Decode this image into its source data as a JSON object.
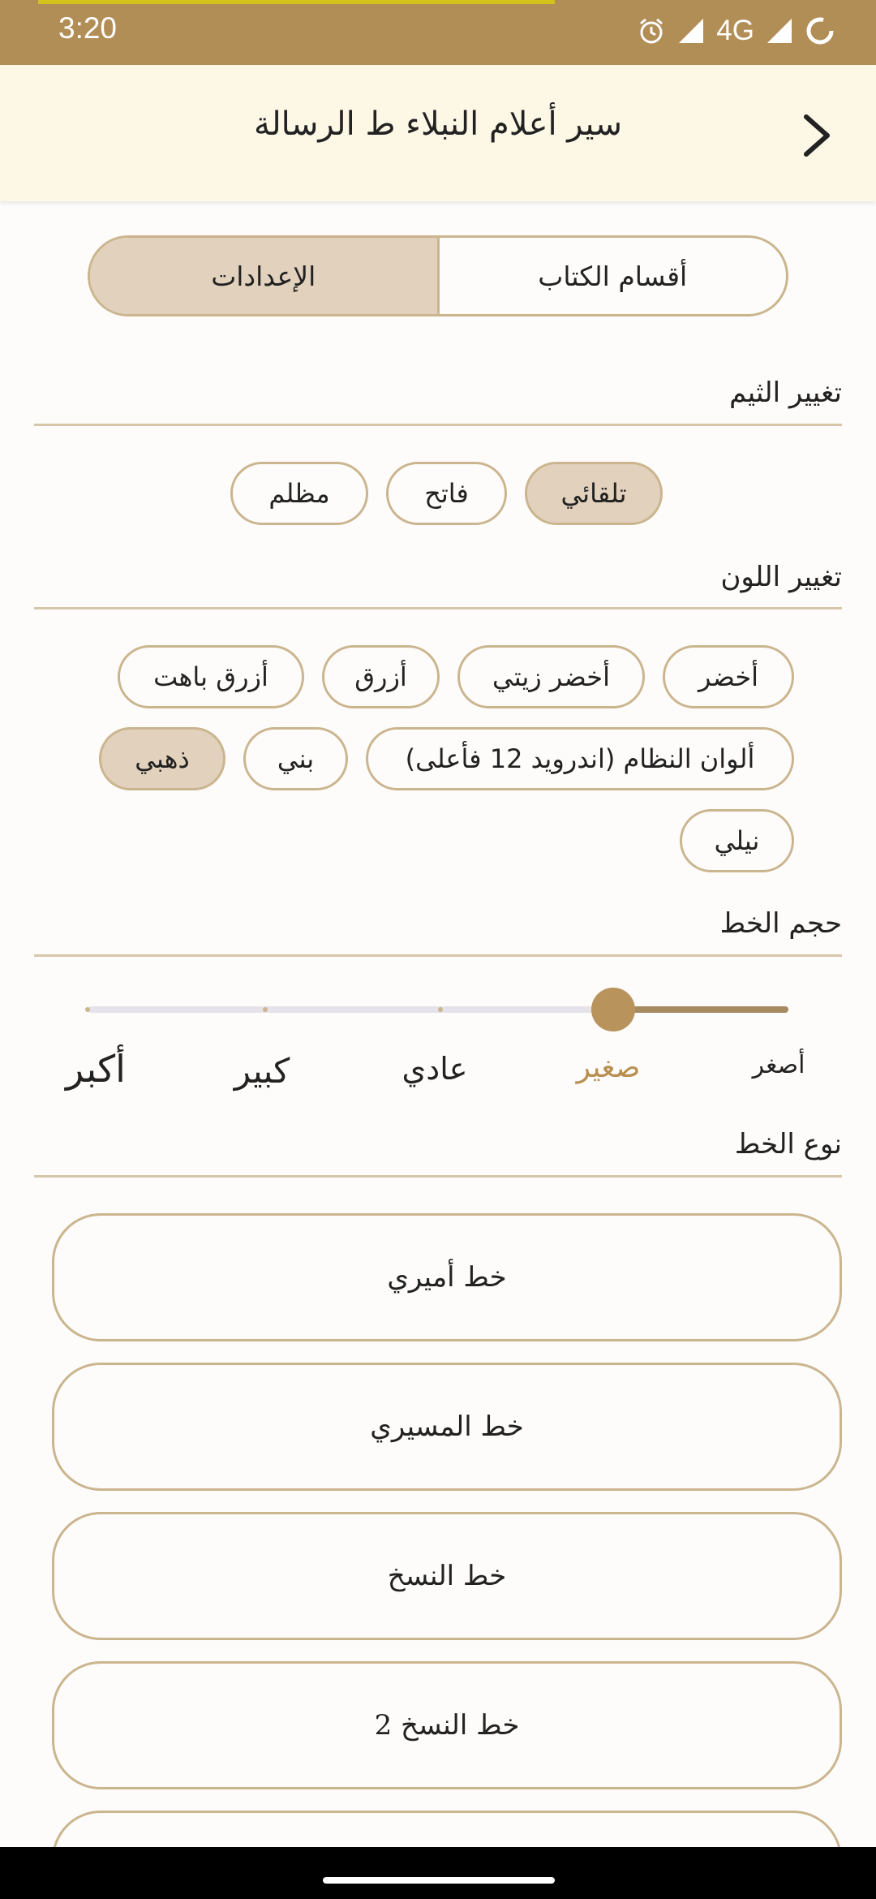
{
  "status": {
    "time": "3:20",
    "network": "4G",
    "icons": [
      "alarm-icon",
      "signal-icon",
      "signal-icon",
      "loading-icon"
    ]
  },
  "header": {
    "title": "سير أعلام النبلاء ط الرسالة",
    "back_icon": "chevron-right-icon"
  },
  "tabs": [
    {
      "label": "الإعدادات",
      "active": true
    },
    {
      "label": "أقسام الكتاب",
      "active": false
    }
  ],
  "theme": {
    "title": "تغيير الثيم",
    "options": [
      "تلقائي",
      "فاتح",
      "مظلم"
    ],
    "selected": "تلقائي"
  },
  "color": {
    "title": "تغيير اللون",
    "options": [
      "أخضر",
      "أخضر زيتي",
      "أزرق",
      "أزرق باهت",
      "ألوان النظام (اندرويد 12 فأعلى)",
      "بني",
      "ذهبي",
      "نيلي"
    ],
    "selected": "ذهبي"
  },
  "font_size": {
    "title": "حجم الخط",
    "labels": [
      "أصغر",
      "صغير",
      "عادي",
      "كبير",
      "أكبر"
    ],
    "selected_index": 1,
    "level_fraction": 0.25
  },
  "font_type": {
    "title": "نوع الخط",
    "options": [
      "خط أميري",
      "خط المسيري",
      "خط النسخ",
      "خط النسخ 2"
    ]
  },
  "colors": {
    "accent": "#b28e57",
    "chip_selected": "#e1d1bd",
    "border": "#cbb58f",
    "header_bg": "#fdf8e6"
  }
}
